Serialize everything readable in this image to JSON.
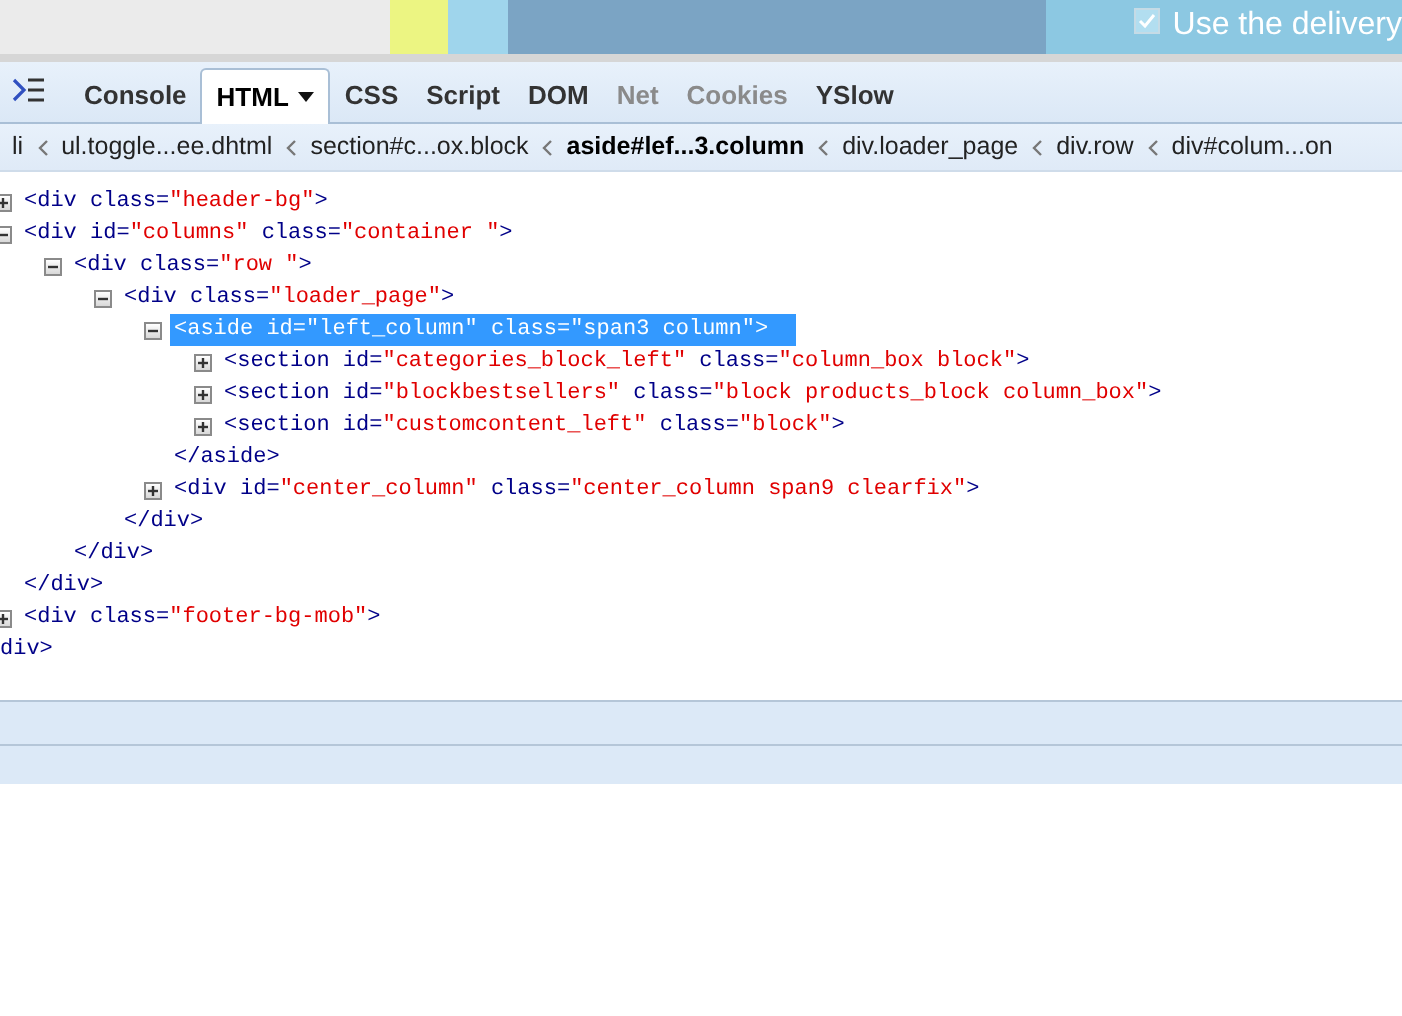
{
  "page_behind": {
    "checkbox_label": "Use the delivery",
    "checked": true
  },
  "toolbar": {
    "tabs": [
      {
        "label": "Console",
        "selected": false,
        "disabled": false,
        "dropdown": false
      },
      {
        "label": "HTML",
        "selected": true,
        "disabled": false,
        "dropdown": true
      },
      {
        "label": "CSS",
        "selected": false,
        "disabled": false,
        "dropdown": false
      },
      {
        "label": "Script",
        "selected": false,
        "disabled": false,
        "dropdown": false
      },
      {
        "label": "DOM",
        "selected": false,
        "disabled": false,
        "dropdown": false
      },
      {
        "label": "Net",
        "selected": false,
        "disabled": true,
        "dropdown": false
      },
      {
        "label": "Cookies",
        "selected": false,
        "disabled": true,
        "dropdown": false
      },
      {
        "label": "YSlow",
        "selected": false,
        "disabled": false,
        "dropdown": false
      }
    ]
  },
  "breadcrumbs": [
    {
      "label": "li",
      "selected": false
    },
    {
      "label": "ul.toggle...ee.dhtml",
      "selected": false
    },
    {
      "label": "section#c...ox.block",
      "selected": false
    },
    {
      "label": "aside#lef...3.column",
      "selected": true
    },
    {
      "label": "div.loader_page",
      "selected": false
    },
    {
      "label": "div.row",
      "selected": false
    },
    {
      "label": "div#colum...on",
      "selected": false
    }
  ],
  "tree": [
    {
      "tokens": [
        {
          "text": "<div class=",
          "kind": "markup"
        },
        {
          "text": "\"header-bg\"",
          "kind": "value"
        },
        {
          "text": ">",
          "kind": "markup"
        }
      ],
      "expanded": false,
      "selected": false
    },
    {
      "tokens": [
        {
          "text": "<div id=",
          "kind": "markup"
        },
        {
          "text": "\"columns\"",
          "kind": "value"
        },
        {
          "text": " class=",
          "kind": "markup"
        },
        {
          "text": "\"container \"",
          "kind": "value"
        },
        {
          "text": ">",
          "kind": "markup"
        }
      ],
      "expanded": true,
      "selected": false,
      "close": "</div>",
      "children": [
        {
          "tokens": [
            {
              "text": "<div class=",
              "kind": "markup"
            },
            {
              "text": "\"row \"",
              "kind": "value"
            },
            {
              "text": ">",
              "kind": "markup"
            }
          ],
          "expanded": true,
          "selected": false,
          "close": "</div>",
          "children": [
            {
              "tokens": [
                {
                  "text": "<div class=",
                  "kind": "markup"
                },
                {
                  "text": "\"loader_page\"",
                  "kind": "value"
                },
                {
                  "text": ">",
                  "kind": "markup"
                }
              ],
              "expanded": true,
              "selected": false,
              "close": "</div>",
              "children": [
                {
                  "tokens": [
                    {
                      "text": "<aside id=",
                      "kind": "markup"
                    },
                    {
                      "text": "\"left_column\"",
                      "kind": "value"
                    },
                    {
                      "text": " class=",
                      "kind": "markup"
                    },
                    {
                      "text": "\"span3 column\"",
                      "kind": "value"
                    },
                    {
                      "text": ">",
                      "kind": "markup"
                    }
                  ],
                  "expanded": true,
                  "selected": true,
                  "close": "</aside>",
                  "children": [
                    {
                      "tokens": [
                        {
                          "text": "<section id=",
                          "kind": "markup"
                        },
                        {
                          "text": "\"categories_block_left\"",
                          "kind": "value"
                        },
                        {
                          "text": " class=",
                          "kind": "markup"
                        },
                        {
                          "text": "\"column_box block\"",
                          "kind": "value"
                        },
                        {
                          "text": ">",
                          "kind": "markup"
                        }
                      ],
                      "expanded": false,
                      "selected": false
                    },
                    {
                      "tokens": [
                        {
                          "text": "<section id=",
                          "kind": "markup"
                        },
                        {
                          "text": "\"blockbestsellers\"",
                          "kind": "value"
                        },
                        {
                          "text": " class=",
                          "kind": "markup"
                        },
                        {
                          "text": "\"block products_block column_box\"",
                          "kind": "value"
                        },
                        {
                          "text": ">",
                          "kind": "markup"
                        }
                      ],
                      "expanded": false,
                      "selected": false
                    },
                    {
                      "tokens": [
                        {
                          "text": "<section id=",
                          "kind": "markup"
                        },
                        {
                          "text": "\"customcontent_left\"",
                          "kind": "value"
                        },
                        {
                          "text": " class=",
                          "kind": "markup"
                        },
                        {
                          "text": "\"block\"",
                          "kind": "value"
                        },
                        {
                          "text": ">",
                          "kind": "markup"
                        }
                      ],
                      "expanded": false,
                      "selected": false
                    }
                  ]
                },
                {
                  "tokens": [
                    {
                      "text": "<div id=",
                      "kind": "markup"
                    },
                    {
                      "text": "\"center_column\"",
                      "kind": "value"
                    },
                    {
                      "text": " class=",
                      "kind": "markup"
                    },
                    {
                      "text": "\"center_column span9 clearfix\"",
                      "kind": "value"
                    },
                    {
                      "text": ">",
                      "kind": "markup"
                    }
                  ],
                  "expanded": false,
                  "selected": false
                }
              ]
            }
          ]
        }
      ]
    },
    {
      "tokens": [
        {
          "text": "<div class=",
          "kind": "markup"
        },
        {
          "text": "\"footer-bg-mob\"",
          "kind": "value"
        },
        {
          "text": ">",
          "kind": "markup"
        }
      ],
      "expanded": false,
      "selected": false
    }
  ],
  "trailing_text": "div>"
}
